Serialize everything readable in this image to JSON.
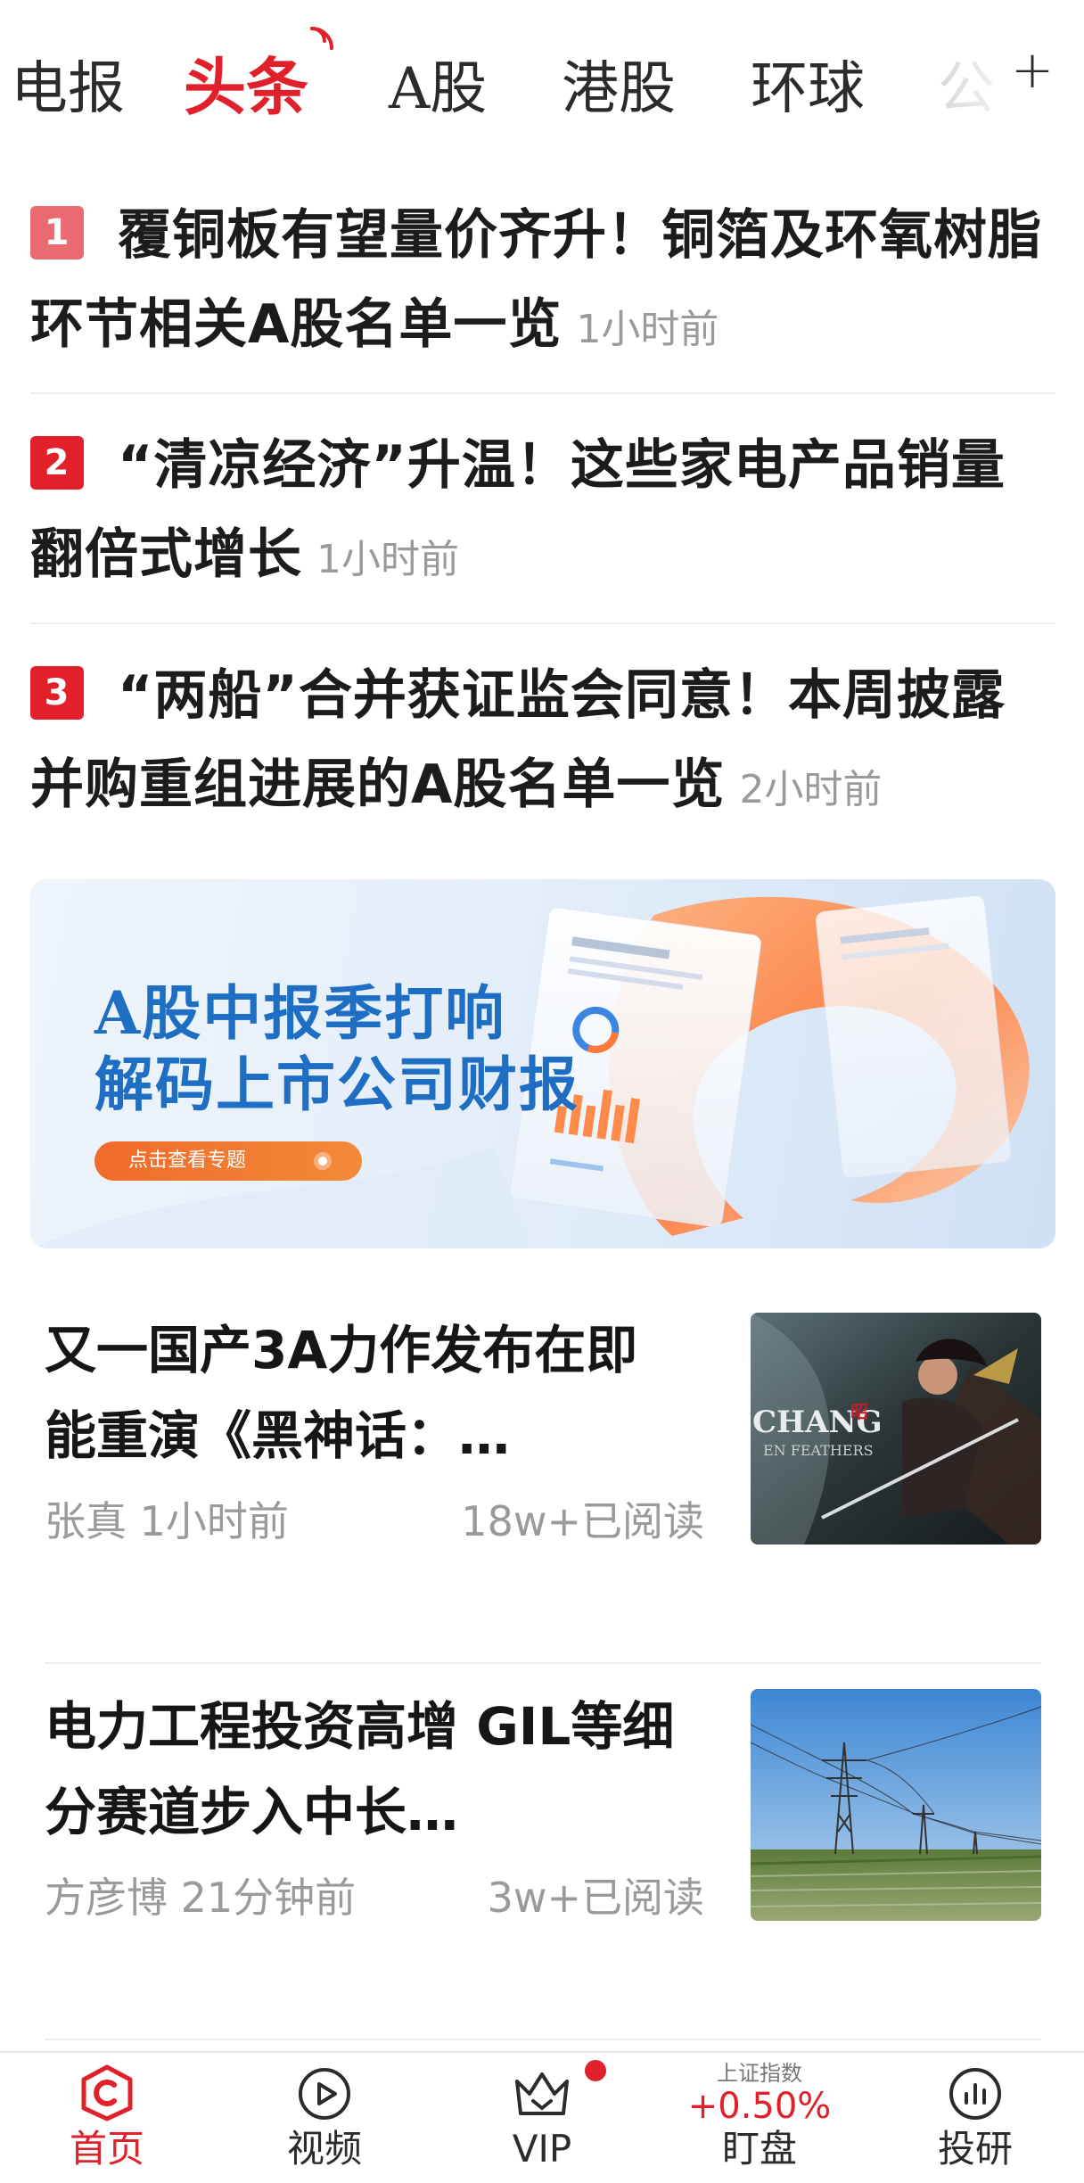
{
  "tabs": [
    {
      "label": "电报"
    },
    {
      "label": "头条"
    },
    {
      "label": "A股"
    },
    {
      "label": "港股"
    },
    {
      "label": "环球"
    },
    {
      "label": "公"
    }
  ],
  "active_tab": "头条",
  "hot_list": [
    {
      "rank": "1",
      "title": "覆铜板有望量价齐升！铜箔及环氧树脂环节相关A股名单一览",
      "time": "1小时前"
    },
    {
      "rank": "2",
      "title": "“清凉经济”升温！这些家电产品销量翻倍式增长",
      "time": "1小时前"
    },
    {
      "rank": "3",
      "title": "“两船”合并获证监会同意！本周披露并购重组进展的A股名单一览",
      "time": "2小时前"
    }
  ],
  "banner": {
    "line1": "A股中报季打响",
    "line2": "解码上市公司财报",
    "button": "点击查看专题"
  },
  "articles": [
    {
      "title": "又一国产3A力作发布在即 能重演《黑神话：…",
      "author": "张真",
      "time": "1小时前",
      "reads": "18w+已阅读",
      "thumb_text": "CHANG",
      "thumb_sub": "EN FEATHERS"
    },
    {
      "title": "电力工程投资高增 GIL等细分赛道步入中长…",
      "author": "方彦博",
      "time": "21分钟前",
      "reads": "3w+已阅读"
    }
  ],
  "bottom_nav": [
    {
      "label": "首页",
      "icon": "home-c-icon"
    },
    {
      "label": "视频",
      "icon": "play-icon"
    },
    {
      "label": "VIP",
      "icon": "crown-icon"
    },
    {
      "label": "盯盘",
      "index_name": "上证指数",
      "index_value": "+0.50%"
    },
    {
      "label": "投研",
      "icon": "chart-circle-icon"
    }
  ],
  "colors": {
    "accent": "#e0202a",
    "rank1": "#ea6a70",
    "banner_text": "#1e6fc4",
    "banner_button": "#f06a2a"
  }
}
